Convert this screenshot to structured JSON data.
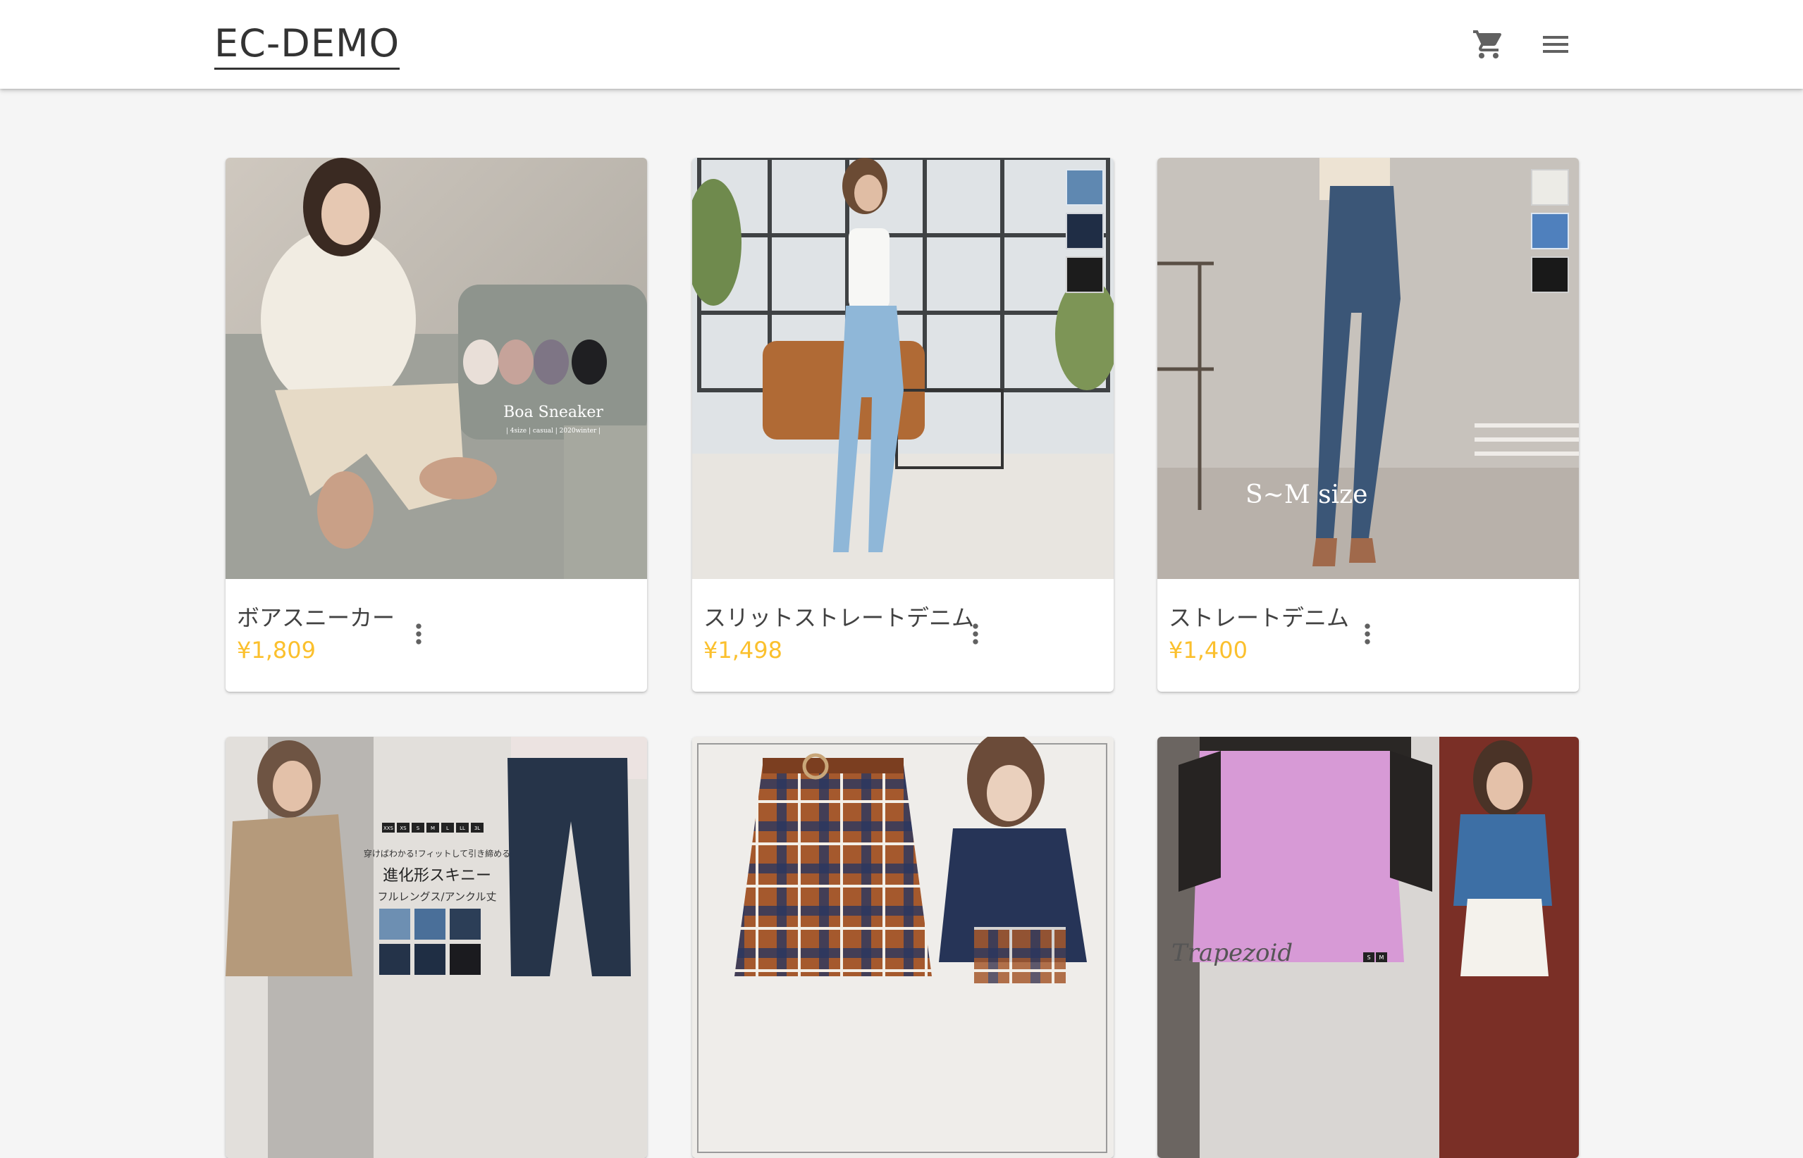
{
  "app": {
    "logo": "EC-DEMO",
    "cart_icon": "cart-icon",
    "menu_icon": "hamburger-menu-icon"
  },
  "colors": {
    "price": "#fbc02d",
    "text": "#424242",
    "icon": "#616161",
    "background": "#f5f5f5"
  },
  "products": [
    {
      "name": "ボアスニーカー",
      "price": "¥1,809",
      "image_text": "Boa Sneaker",
      "image_subtext": "| 4size | casual | 2020winter |",
      "swatches": []
    },
    {
      "name": "スリットストレートデニム",
      "price": "¥1,498",
      "image_text": "",
      "image_subtext": "",
      "swatches": [
        "#5f88b1",
        "#1f2d45",
        "#1c1c1c"
      ]
    },
    {
      "name": "ストレートデニム",
      "price": "¥1,400",
      "image_text": "S~M size",
      "image_subtext": "",
      "swatches": [
        "#ecebe6",
        "#4f80bd",
        "#191919"
      ]
    },
    {
      "name": "",
      "price": "",
      "image_text": "進化形スキニー",
      "image_subtext": "フルレングス/アンクル丈",
      "image_caption": "穿けばわかる!フィットして引き締める",
      "size_tags": [
        "XXS",
        "XS",
        "S",
        "M",
        "L",
        "LL",
        "3L"
      ],
      "swatches": []
    },
    {
      "name": "",
      "price": "",
      "image_text": "",
      "image_subtext": "",
      "swatches": []
    },
    {
      "name": "",
      "price": "",
      "image_text": "Trapezoid",
      "image_subtext": "",
      "size_tags": [
        "S",
        "M"
      ],
      "swatches": []
    }
  ]
}
